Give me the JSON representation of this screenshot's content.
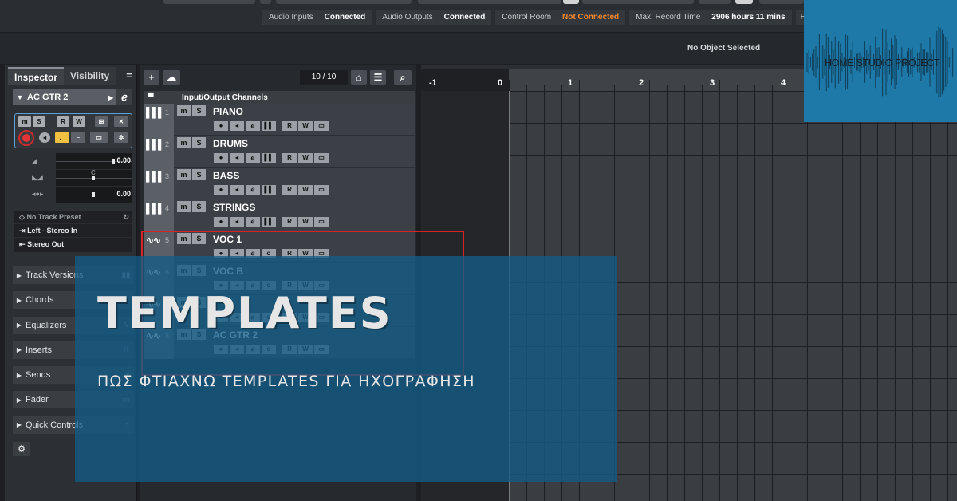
{
  "status_bar": {
    "items": [
      {
        "key": "Audio Inputs",
        "value": "Connected",
        "state": "ok"
      },
      {
        "key": "Audio Outputs",
        "value": "Connected",
        "state": "ok"
      },
      {
        "key": "Control Room",
        "value": "Not Connected",
        "state": "warn"
      },
      {
        "key": "Max. Record Time",
        "value": "2906 hours 11 mins",
        "state": "ok"
      },
      {
        "key": "Re",
        "value": "",
        "state": "ok"
      }
    ]
  },
  "info_line": {
    "text": "No Object Selected"
  },
  "inspector": {
    "tab_inspector": "Inspector",
    "tab_visibility": "Visibility",
    "menu_glyph": "=",
    "track_name": "AC GTR 2",
    "btn_m": "m",
    "btn_s": "S",
    "btn_r": "R",
    "btn_w": "W",
    "volume_value": "0.00",
    "pan_label": "C",
    "delay_value": "0.00",
    "preset": "No Track Preset",
    "input": "Left - Stereo In",
    "output": "Stereo Out",
    "sections": [
      "Track Versions",
      "Chords",
      "Equalizers",
      "Inserts",
      "Sends",
      "Fader",
      "Quick Controls"
    ]
  },
  "track_list": {
    "count": "10 / 10",
    "folder_name": "Input/Output Channels",
    "btn_m": "m",
    "btn_s": "S",
    "btn_r": "R",
    "btn_w": "W",
    "tracks": [
      {
        "num": "1",
        "name": "PIANO",
        "kind": "instrument"
      },
      {
        "num": "2",
        "name": "DRUMS",
        "kind": "instrument"
      },
      {
        "num": "3",
        "name": "BASS",
        "kind": "instrument"
      },
      {
        "num": "4",
        "name": "STRINGS",
        "kind": "instrument"
      },
      {
        "num": "5",
        "name": "VOC 1",
        "kind": "audio"
      },
      {
        "num": "6",
        "name": "VOC B",
        "kind": "audio"
      },
      {
        "num": "7",
        "name": "",
        "kind": "audio"
      },
      {
        "num": "8",
        "name": "AC GTR 2",
        "kind": "audio"
      }
    ]
  },
  "ruler": {
    "labels": [
      "-1",
      "0",
      "1",
      "2",
      "3",
      "4"
    ]
  },
  "logo": {
    "text": "HOME STUDIO PROJECT",
    "color": "#1f79a8"
  },
  "overlay": {
    "title": "TEMPLATES",
    "subtitle": "ΠΩΣ ΦΤΙΑΧΝΩ TEMPLATES ΓΙΑ ΗΧΟΓΡΑΦΗΣΗ",
    "color": "#125c88"
  },
  "colors": {
    "accent_blue": "#5d9fd6",
    "record_red": "#e13535",
    "warning_orange": "#ff8a2a",
    "selection_red": "#d62424"
  }
}
